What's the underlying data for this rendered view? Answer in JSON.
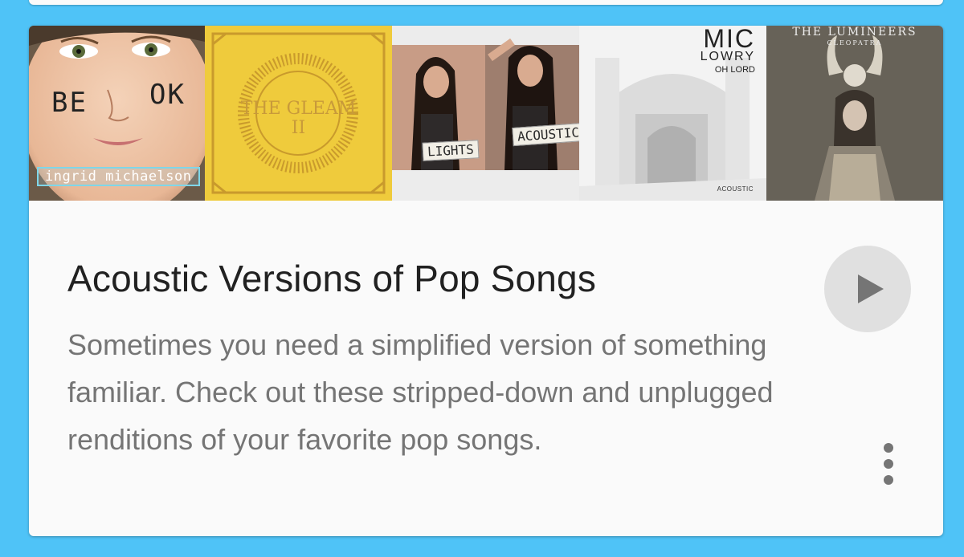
{
  "card": {
    "title": "Acoustic Versions of Pop Songs",
    "description": "Sometimes you need a simplified version of something familiar. Check out these stripped-down and unplugged renditions of your favorite pop songs."
  },
  "albums": [
    {
      "name": "be-ok",
      "cover_text": [
        "BE",
        "OK"
      ],
      "artist_text": "ingrid michaelson"
    },
    {
      "name": "the-gleam-ii",
      "cover_text": [
        "THE GLEAM",
        "II"
      ]
    },
    {
      "name": "lights-acoustic",
      "cover_text": [
        "LIGHTS",
        "ACOUSTIC"
      ]
    },
    {
      "name": "oh-lord",
      "cover_text": [
        "MIC",
        "LOWRY",
        "OH LORD",
        "ACOUSTIC"
      ]
    },
    {
      "name": "cleopatra",
      "cover_text": [
        "THE LUMINEERS",
        "CLEOPATRA"
      ]
    }
  ],
  "icons": {
    "play": "play-icon",
    "more": "more-vertical-icon"
  },
  "colors": {
    "background": "#4fc3f7",
    "card": "#fafafa",
    "title": "#212121",
    "description": "#757575",
    "play_button_bg": "#e0e0e0",
    "icon": "#757575"
  }
}
